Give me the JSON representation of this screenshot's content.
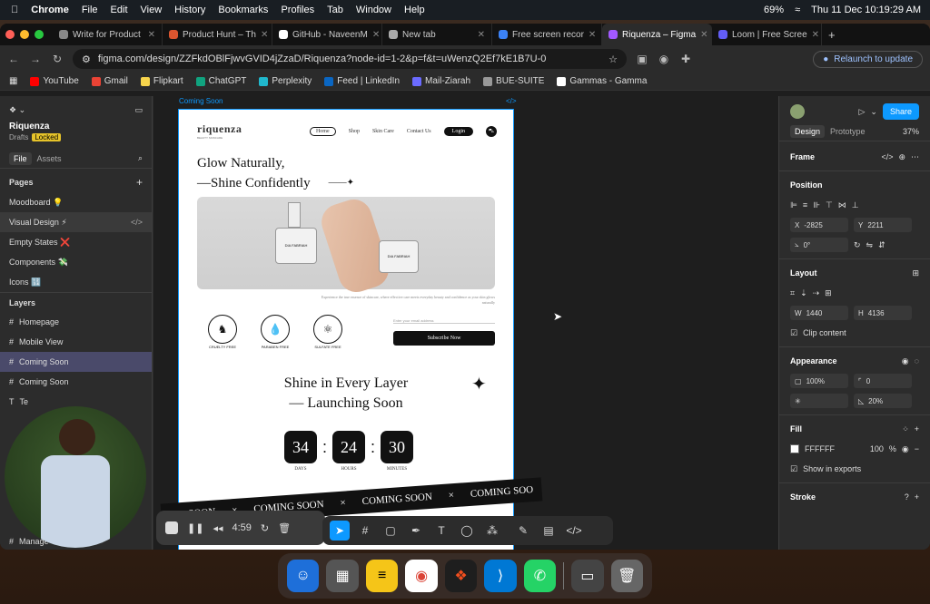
{
  "menubar": {
    "app": "Chrome",
    "items": [
      "File",
      "Edit",
      "View",
      "History",
      "Bookmarks",
      "Profiles",
      "Tab",
      "Window",
      "Help"
    ],
    "battery": "69%",
    "datetime": "Thu 11 Dec  10:19:29 AM"
  },
  "tabs": [
    {
      "label": "Write for Product",
      "color": "#888888"
    },
    {
      "label": "Product Hunt – Th",
      "color": "#da552f"
    },
    {
      "label": "GitHub - NaveenM",
      "color": "#ffffff"
    },
    {
      "label": "New tab",
      "color": "#aaaaaa"
    },
    {
      "label": "Free screen recor",
      "color": "#3b82f6"
    },
    {
      "label": "Riquenza – Figma",
      "color": "#a259ff",
      "active": true
    },
    {
      "label": "Loom | Free Scree",
      "color": "#625df5"
    }
  ],
  "address": {
    "url": "figma.com/design/ZZFkdOBlFjwvGVID4jZzaD/Riquenza?node-id=1-2&p=f&t=uWenzQ2Ef7kE1B7U-0",
    "relaunch": "Relaunch to update"
  },
  "bookmarks": [
    {
      "label": "YouTube",
      "color": "#ff0000"
    },
    {
      "label": "Gmail",
      "color": "#ea4335"
    },
    {
      "label": "Flipkart",
      "color": "#f7d44c"
    },
    {
      "label": "ChatGPT",
      "color": "#10a37f"
    },
    {
      "label": "Perplexity",
      "color": "#20b8cd"
    },
    {
      "label": "Feed | LinkedIn",
      "color": "#0a66c2"
    },
    {
      "label": "Mail-Ziarah",
      "color": "#6b6bff"
    },
    {
      "label": "BUE-SUITE",
      "color": "#999999"
    },
    {
      "label": "Gammas - Gamma",
      "color": "#ffffff"
    }
  ],
  "left_panel": {
    "file_name": "Riquenza",
    "drafts": "Drafts",
    "locked": "Locked",
    "tab_file": "File",
    "tab_assets": "Assets",
    "pages_label": "Pages",
    "pages": [
      "Moodboard 💡",
      "Visual Design ⚡",
      "Empty States ❌",
      "Components 💸",
      "Icons 🔢"
    ],
    "layers_label": "Layers",
    "layers": [
      "Homepage",
      "Mobile View",
      "Coming Soon",
      "Coming Soon"
    ],
    "layers_partial": [
      "Te",
      "Manage"
    ]
  },
  "canvas": {
    "frame_label": "Coming Soon",
    "site": {
      "logo": "riquenza",
      "logo_sub": "BEAUTY SKINCARE",
      "nav": [
        "Home",
        "Shop",
        "Skin Care",
        "Contact Us"
      ],
      "login": "Login",
      "hero_line1": "Glow Naturally,",
      "hero_line2": "—Shine Confidently",
      "jar_label": "DIA FABRIAH",
      "para": "Experience the true essence of skincare, where effective care meets everyday beauty and confidence as your skin glows naturally",
      "badges": [
        "CRUELTY FREE",
        "PARABEN FREE",
        "SULFATE FREE"
      ],
      "email_placeholder": "Enter your email address",
      "subscribe": "Subscribe Now",
      "shine_line1": "Shine in Every Layer",
      "shine_line2": "— Launching Soon",
      "countdown": [
        {
          "value": "34",
          "unit": "DAYS"
        },
        {
          "value": "24",
          "unit": "HOURS"
        },
        {
          "value": "30",
          "unit": "MINUTES"
        }
      ],
      "banner": [
        "SOON",
        "COMING SOON",
        "COMING SOON",
        "COMING SOO"
      ]
    }
  },
  "right_panel": {
    "share": "Share",
    "tab_design": "Design",
    "tab_prototype": "Prototype",
    "zoom": "37%",
    "frame": "Frame",
    "position_label": "Position",
    "x": "-2825",
    "y": "2211",
    "rotation": "0°",
    "layout_label": "Layout",
    "w": "1440",
    "h": "4136",
    "clip": "Clip content",
    "appearance_label": "Appearance",
    "opacity": "100%",
    "radius": "0",
    "blur": "20%",
    "fill_label": "Fill",
    "fill_hex": "FFFFFF",
    "fill_opacity": "100",
    "fill_unit": "%",
    "show_exports": "Show in exports",
    "stroke_label": "Stroke"
  },
  "recorder": {
    "time": "4:59"
  }
}
